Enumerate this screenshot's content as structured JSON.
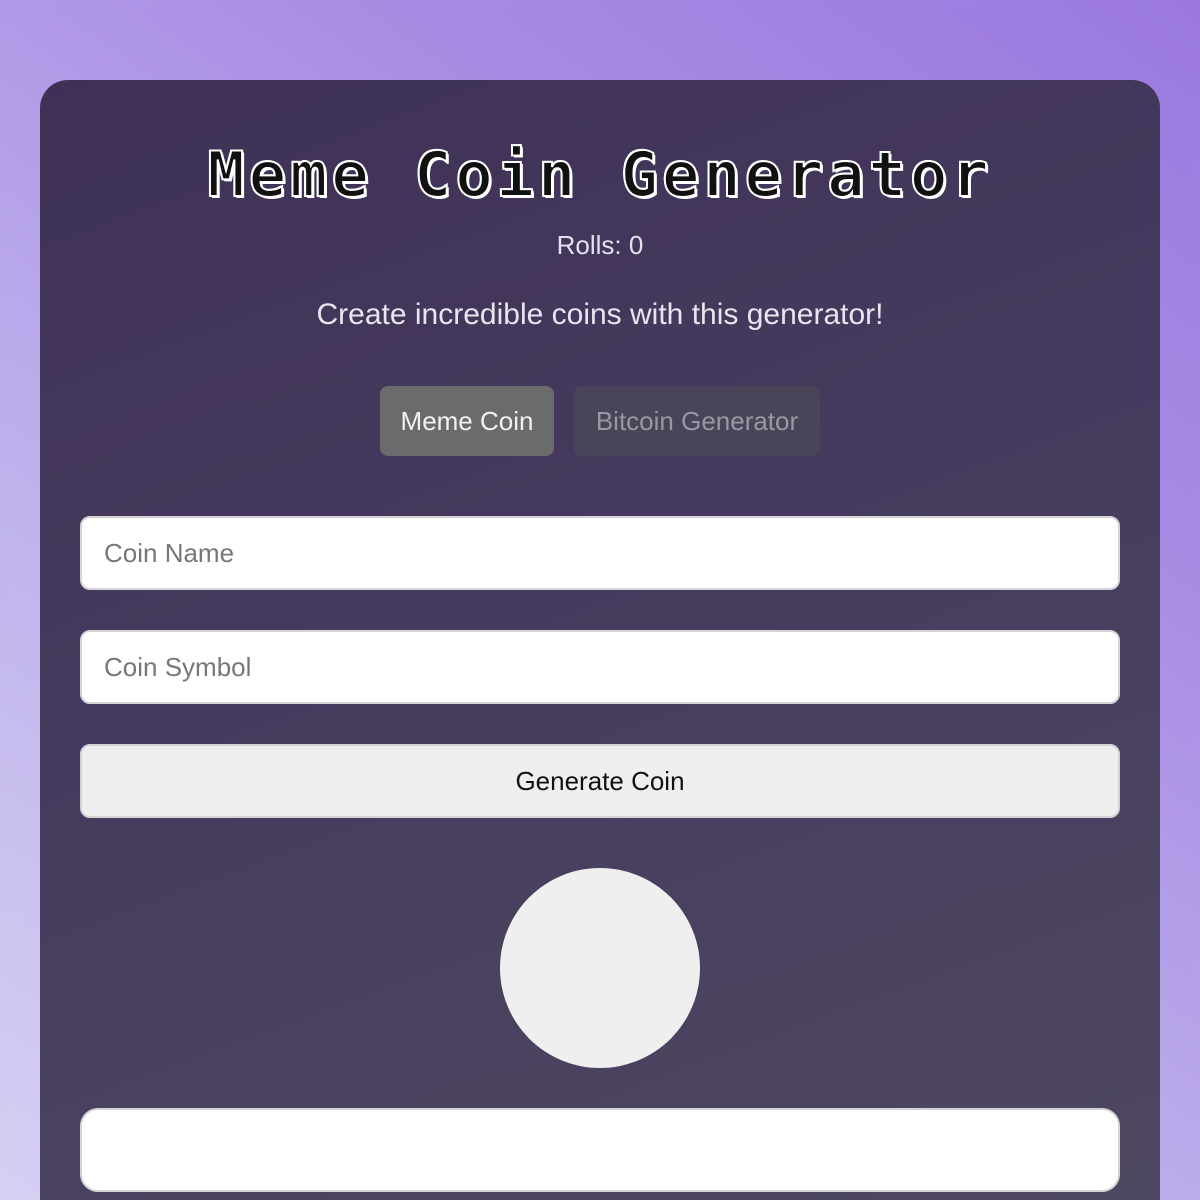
{
  "header": {
    "title": "Meme Coin Generator",
    "rolls_text": "Rolls: 0",
    "subtitle": "Create incredible coins with this generator!"
  },
  "tabs": [
    {
      "label": "Meme Coin",
      "active": true
    },
    {
      "label": "Bitcoin Generator",
      "active": false
    }
  ],
  "form": {
    "coin_name": {
      "value": "",
      "placeholder": "Coin Name"
    },
    "coin_symbol": {
      "value": "",
      "placeholder": "Coin Symbol"
    },
    "generate_label": "Generate Coin"
  },
  "colors": {
    "background_start": "#d6d0f2",
    "background_end": "#9a78df",
    "card": "#463b5e",
    "active_tab": "#6b6b6e",
    "inactive_tab": "#4a4458",
    "button": "#efefef",
    "coin": "#efefef"
  }
}
